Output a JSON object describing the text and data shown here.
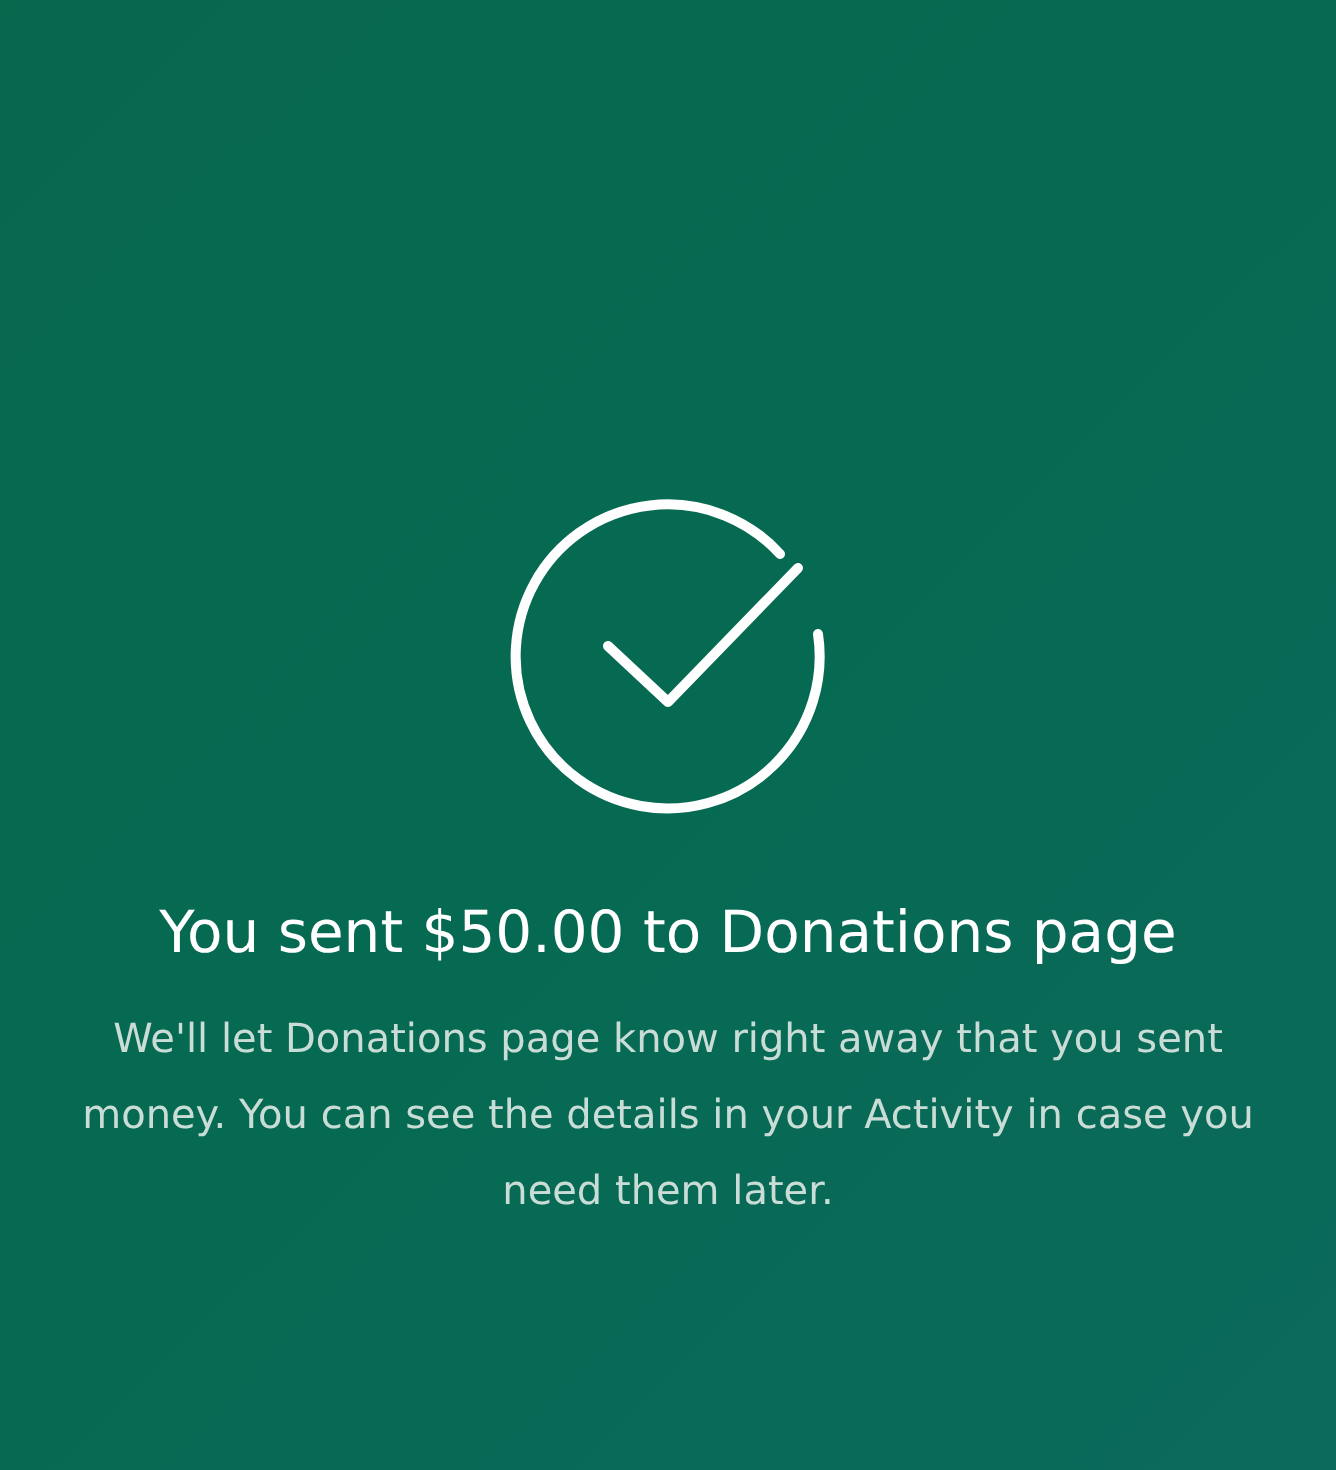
{
  "confirmation": {
    "title": "You sent $50.00 to Donations page",
    "message": "We'll let Donations page know right away that you sent money. You can see the details in your Activity in case you need them later."
  }
}
